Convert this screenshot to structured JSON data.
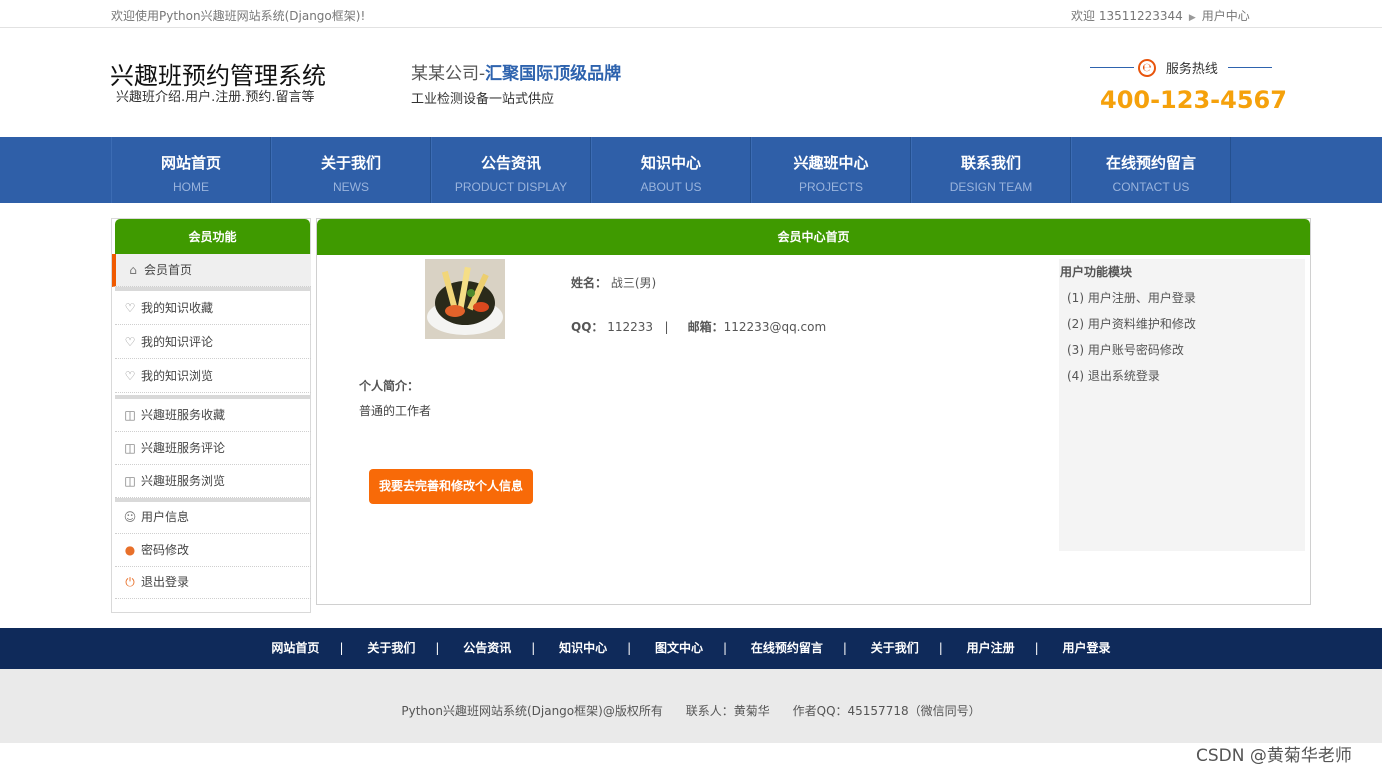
{
  "topbar": {
    "welcome": "欢迎使用Python兴趣班网站系统(Django框架)!",
    "greeting": "欢迎 13511223344",
    "user_center": "用户中心"
  },
  "header": {
    "site_title": "兴趣班预约管理系统",
    "site_subtitle": "兴趣班介绍.用户.注册.预约.留言等",
    "slogan_prefix": "某某公司-",
    "slogan_highlight": "汇聚国际顶级品牌",
    "slogan_sub": "工业检测设备一站式供应",
    "hotline_label": "服务热线",
    "phone": "400-123-4567"
  },
  "nav": [
    {
      "cn": "网站首页",
      "en": "HOME"
    },
    {
      "cn": "关于我们",
      "en": "NEWS"
    },
    {
      "cn": "公告资讯",
      "en": "PRODUCT DISPLAY"
    },
    {
      "cn": "知识中心",
      "en": "ABOUT US"
    },
    {
      "cn": "兴趣班中心",
      "en": "PROJECTS"
    },
    {
      "cn": "联系我们",
      "en": "DESIGN TEAM"
    },
    {
      "cn": "在线预约留言",
      "en": "CONTACT US"
    }
  ],
  "sidebar": {
    "title": "会员功能",
    "items": [
      {
        "label": "会员首页",
        "icon": "home-icon"
      },
      {
        "label": "我的知识收藏",
        "icon": "heart-icon"
      },
      {
        "label": "我的知识评论",
        "icon": "heart-icon"
      },
      {
        "label": "我的知识浏览",
        "icon": "heart-icon"
      },
      {
        "label": "兴趣班服务收藏",
        "icon": "wallet-icon"
      },
      {
        "label": "兴趣班服务评论",
        "icon": "wallet-icon"
      },
      {
        "label": "兴趣班服务浏览",
        "icon": "wallet-icon"
      },
      {
        "label": "用户信息",
        "icon": "user-icon"
      },
      {
        "label": "密码修改",
        "icon": "lock-icon"
      },
      {
        "label": "退出登录",
        "icon": "power-icon"
      }
    ]
  },
  "main": {
    "title": "会员中心首页",
    "name_label": "姓名：",
    "name_value": "战三(男)",
    "qq_label": "QQ：",
    "qq_value": "112233",
    "divider": "|",
    "email_label": "邮箱：",
    "email_value": "112233@qq.com",
    "intro_label": "个人简介：",
    "intro_text": "普通的工作者",
    "edit_button": "我要去完善和修改个人信息",
    "modules_title": "用户功能模块",
    "modules": [
      "(1) 用户注册、用户登录",
      "(2) 用户资料维护和修改",
      "(3) 用户账号密码修改",
      "(4) 退出系统登录"
    ]
  },
  "footer_nav": [
    "网站首页",
    "关于我们",
    "公告资讯",
    "知识中心",
    "图文中心",
    "在线预约留言",
    "关于我们",
    "用户注册",
    "用户登录"
  ],
  "footer": {
    "copyright": "Python兴趣班网站系统(Django框架)@版权所有",
    "contact": "联系人：黄菊华",
    "author_qq": "作者QQ：45157718（微信同号）"
  },
  "watermark": "CSDN @黄菊华老师",
  "colors": {
    "nav_bg": "#2f5fa8",
    "green_header": "#3f9a00",
    "orange_button": "#f86a08",
    "phone": "#f5a10b",
    "footer_nav_bg": "#0f2a5a"
  }
}
